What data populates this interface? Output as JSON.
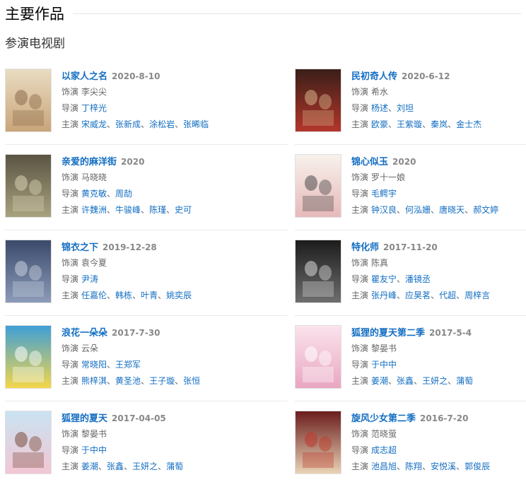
{
  "header": {
    "title": "主要作品",
    "subtitle": "参演电视剧"
  },
  "labels": {
    "role": "饰演",
    "director": "导演",
    "cast": "主演",
    "separator": "、"
  },
  "works": [
    {
      "title": "以家人之名",
      "date": "2020-8-10",
      "role": "李尖尖",
      "directors": [
        "丁梓光"
      ],
      "cast": [
        "宋威龙",
        "张新成",
        "涂松岩",
        "张晞临"
      ],
      "poster_colors": [
        "#e9dcc2",
        "#c9a57a",
        "#8a6b4a"
      ]
    },
    {
      "title": "民初奇人传",
      "date": "2020-6-12",
      "role": "希水",
      "directors": [
        "杨述",
        "刘坦"
      ],
      "cast": [
        "欧豪",
        "王紫璇",
        "秦岚",
        "金士杰"
      ],
      "poster_colors": [
        "#3a1f18",
        "#b3362b",
        "#d9b48a"
      ]
    },
    {
      "title": "亲爱的麻洋街",
      "date": "2020",
      "role": "马晓晓",
      "directors": [
        "黄克敏",
        "周劼"
      ],
      "cast": [
        "许魏洲",
        "牛骏峰",
        "陈瑾",
        "史可"
      ],
      "poster_colors": [
        "#5a5443",
        "#a9a27f",
        "#d9d2b5"
      ]
    },
    {
      "title": "锦心似玉",
      "date": "2020",
      "role": "罗十一娘",
      "directors": [
        "毛鳄宇"
      ],
      "cast": [
        "钟汉良",
        "何泓姗",
        "唐晓天",
        "郝文婷"
      ],
      "poster_colors": [
        "#f7f1ec",
        "#e7b9b9",
        "#4a4a4a"
      ]
    },
    {
      "title": "锦衣之下",
      "date": "2019-12-28",
      "role": "袁今夏",
      "directors": [
        "尹涛"
      ],
      "cast": [
        "任嘉伦",
        "韩栋",
        "叶青",
        "姚奕辰"
      ],
      "poster_colors": [
        "#3b4a6b",
        "#8b9bb8",
        "#c9d1df"
      ]
    },
    {
      "title": "特化师",
      "date": "2017-11-20",
      "role": "陈真",
      "directors": [
        "瞿友宁",
        "潘镜丞"
      ],
      "cast": [
        "张丹峰",
        "应昊茗",
        "代超",
        "周梓言"
      ],
      "poster_colors": [
        "#1c1c1c",
        "#6e6e6e",
        "#d8d8d8"
      ]
    },
    {
      "title": "浪花一朵朵",
      "date": "2017-7-30",
      "role": "云朵",
      "directors": [
        "常晓阳",
        "王郑军"
      ],
      "cast": [
        "熊梓淇",
        "黄圣池",
        "王子璇",
        "张恒"
      ],
      "poster_colors": [
        "#3f9fd6",
        "#f3d64a",
        "#ffffff"
      ]
    },
    {
      "title": "狐狸的夏天第二季",
      "date": "2017-5-4",
      "role": "黎晏书",
      "directors": [
        "于中中"
      ],
      "cast": [
        "姜潮",
        "张鑫",
        "王妍之",
        "蒲萄"
      ],
      "poster_colors": [
        "#fbe3ec",
        "#e9a6c1",
        "#ffffff"
      ]
    },
    {
      "title": "狐狸的夏天",
      "date": "2017-04-05",
      "role": "黎晏书",
      "directors": [
        "于中中"
      ],
      "cast": [
        "姜潮",
        "张鑫",
        "王妍之",
        "蒲萄"
      ],
      "poster_colors": [
        "#c9e3f2",
        "#f2c6d4",
        "#7a4b3a"
      ]
    },
    {
      "title": "旋风少女第二季",
      "date": "2016-7-20",
      "role": "范晓萤",
      "directors": [
        "成志超"
      ],
      "cast": [
        "池昌旭",
        "陈翔",
        "安悦溪",
        "郭俊辰"
      ],
      "poster_colors": [
        "#6b1d1d",
        "#e9d3b6",
        "#c0392b"
      ]
    }
  ]
}
